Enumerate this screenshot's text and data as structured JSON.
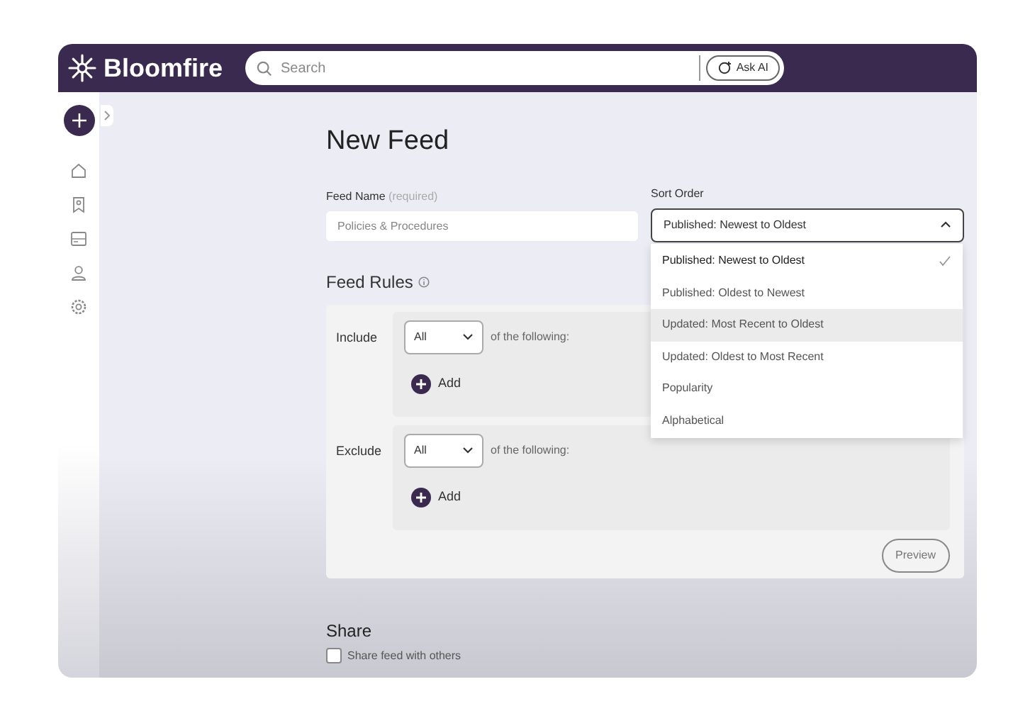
{
  "header": {
    "logo": "Bloomfire",
    "search": {
      "placeholder": "Search"
    },
    "ask_ai": "Ask AI"
  },
  "sidebar": {
    "items": [
      {
        "kind": "home"
      },
      {
        "kind": "bookmark"
      },
      {
        "kind": "layout"
      },
      {
        "kind": "people"
      },
      {
        "kind": "settings"
      }
    ]
  },
  "page_title": "New Feed",
  "feed_name": {
    "label": "Feed Name",
    "hint": "(required)",
    "placeholder": "Policies & Procedures"
  },
  "sort_order": {
    "label": "Sort Order",
    "value": "Published: Newest to Oldest",
    "expanded": true,
    "options": [
      {
        "label": "Published: Newest to Oldest",
        "selected": true,
        "hovered": false
      },
      {
        "label": "Published: Oldest to Newest",
        "selected": false,
        "hovered": false
      },
      {
        "label": "Updated: Most Recent to Oldest",
        "selected": false,
        "hovered": true
      },
      {
        "label": "Updated: Oldest to Most Recent",
        "selected": false,
        "hovered": false
      },
      {
        "label": "Popularity",
        "selected": false,
        "hovered": false
      },
      {
        "label": "Alphabetical",
        "selected": false,
        "hovered": false
      }
    ]
  },
  "feed_rules": {
    "title": "Feed Rules",
    "rules": [
      {
        "label": "Include",
        "match": "All",
        "suffix": "of the following:",
        "add": "Add"
      },
      {
        "label": "Exclude",
        "match": "All",
        "suffix": "of the following:",
        "add": "Add"
      }
    ],
    "preview": "Preview"
  },
  "share": {
    "title": "Share",
    "checkbox": {
      "label": "Share feed with others",
      "checked": false
    }
  }
}
